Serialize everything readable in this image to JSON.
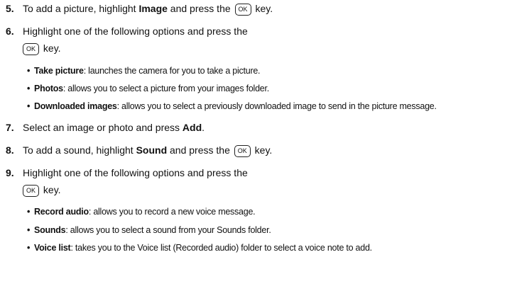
{
  "key_label": "OK",
  "steps": {
    "s5": {
      "num": "5.",
      "a": "To add a picture, highlight ",
      "bold": "Image",
      "b": " and press the ",
      "c": " key."
    },
    "s6": {
      "num": "6.",
      "a": "Highlight one of the following options and press the",
      "cont": " key."
    },
    "s6_bullets": [
      {
        "term": "Take picture",
        "desc": ": launches the camera for you to take a picture."
      },
      {
        "term": "Photos",
        "desc": ": allows you to select a picture from your images folder."
      },
      {
        "term": "Downloaded images",
        "desc": ": allows you to select a previously downloaded image to send in the picture message."
      }
    ],
    "s7": {
      "num": "7.",
      "a": "Select an image or photo and press ",
      "bold": "Add",
      "b": "."
    },
    "s8": {
      "num": "8.",
      "a": "To add a sound, highlight ",
      "bold": "Sound",
      "b": " and press the ",
      "c": " key."
    },
    "s9": {
      "num": "9.",
      "a": "Highlight one of the following options and press the",
      "cont": " key."
    },
    "s9_bullets": [
      {
        "term": "Record audio",
        "desc": ": allows you to record a new voice message."
      },
      {
        "term": "Sounds",
        "desc": ": allows you to select a sound from your Sounds folder."
      },
      {
        "term": "Voice list",
        "desc": ": takes you to the Voice list (Recorded audio) folder to select a voice note to add."
      }
    ]
  }
}
